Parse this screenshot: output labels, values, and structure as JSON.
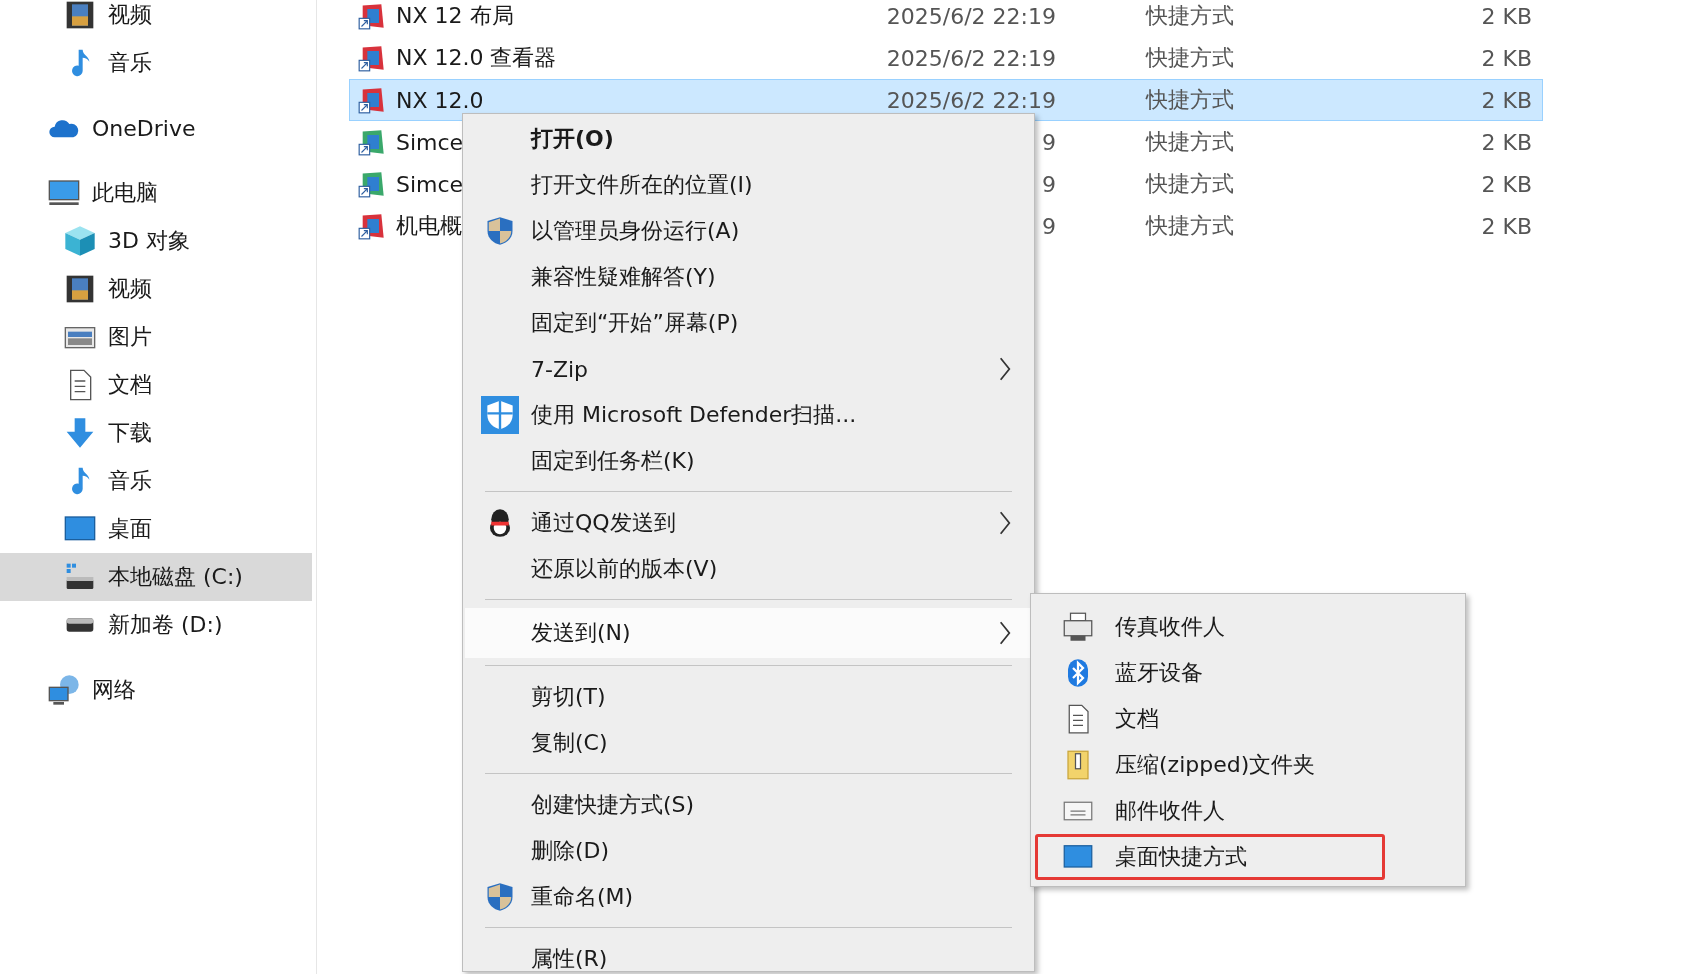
{
  "sidebar": {
    "partial_items": [
      {
        "label": "视频",
        "kind": "video",
        "selected": false
      },
      {
        "label": "音乐",
        "kind": "music",
        "selected": false
      }
    ],
    "items": [
      {
        "label": "OneDrive",
        "kind": "cloud",
        "selected": false
      },
      {
        "label": "此电脑",
        "kind": "pc",
        "selected": false,
        "children": [
          {
            "label": "3D 对象",
            "kind": "cube",
            "selected": false
          },
          {
            "label": "视频",
            "kind": "video",
            "selected": false
          },
          {
            "label": "图片",
            "kind": "pictures",
            "selected": false
          },
          {
            "label": "文档",
            "kind": "docs",
            "selected": false
          },
          {
            "label": "下载",
            "kind": "download",
            "selected": false
          },
          {
            "label": "音乐",
            "kind": "music",
            "selected": false
          },
          {
            "label": "桌面",
            "kind": "desktop",
            "selected": false
          },
          {
            "label": "本地磁盘 (C:)",
            "kind": "systemdisk",
            "selected": true
          },
          {
            "label": "新加卷 (D:)",
            "kind": "disk",
            "selected": false
          }
        ]
      },
      {
        "label": "网络",
        "kind": "network",
        "selected": false
      }
    ]
  },
  "files": {
    "rows": [
      {
        "name": "NX 12 布局",
        "kind": "nx",
        "date": "2025/6/2 22:19",
        "type": "快捷方式",
        "size": "2 KB",
        "selected": false
      },
      {
        "name": "NX 12.0 查看器",
        "kind": "nx",
        "date": "2025/6/2 22:19",
        "type": "快捷方式",
        "size": "2 KB",
        "selected": false
      },
      {
        "name": "NX 12.0",
        "kind": "nx",
        "date": "2025/6/2 22:19",
        "type": "快捷方式",
        "size": "2 KB",
        "selected": true
      },
      {
        "name": "Simce",
        "kind": "simcenter",
        "date": "9",
        "type": "快捷方式",
        "size": "2 KB",
        "selected": false
      },
      {
        "name": "Simce",
        "kind": "simcenter",
        "date": "9",
        "type": "快捷方式",
        "size": "2 KB",
        "selected": false
      },
      {
        "name": "机电概",
        "kind": "nx",
        "date": "9",
        "type": "快捷方式",
        "size": "2 KB",
        "selected": false
      }
    ]
  },
  "context_menu": {
    "groups": [
      [
        {
          "label": "打开(O)",
          "kind": "plain",
          "default": true,
          "submenu": false,
          "selected": false
        },
        {
          "label": "打开文件所在的位置(I)",
          "kind": "plain",
          "default": false,
          "submenu": false,
          "selected": false
        },
        {
          "label": "以管理员身份运行(A)",
          "kind": "shield",
          "default": false,
          "submenu": false,
          "selected": false
        },
        {
          "label": "兼容性疑难解答(Y)",
          "kind": "plain",
          "default": false,
          "submenu": false,
          "selected": false
        },
        {
          "label": "固定到“开始”屏幕(P)",
          "kind": "plain",
          "default": false,
          "submenu": false,
          "selected": false
        },
        {
          "label": "7-Zip",
          "kind": "plain",
          "default": false,
          "submenu": true,
          "selected": false
        },
        {
          "label": "使用 Microsoft Defender扫描...",
          "kind": "defender",
          "default": false,
          "submenu": false,
          "selected": false
        },
        {
          "label": "固定到任务栏(K)",
          "kind": "plain",
          "default": false,
          "submenu": false,
          "selected": false
        }
      ],
      [
        {
          "label": "通过QQ发送到",
          "kind": "qq",
          "default": false,
          "submenu": true,
          "selected": false
        },
        {
          "label": "还原以前的版本(V)",
          "kind": "plain",
          "default": false,
          "submenu": false,
          "selected": false
        }
      ],
      [
        {
          "label": "发送到(N)",
          "kind": "plain",
          "default": false,
          "submenu": true,
          "selected": true
        }
      ],
      [
        {
          "label": "剪切(T)",
          "kind": "plain",
          "default": false,
          "submenu": false,
          "selected": false
        },
        {
          "label": "复制(C)",
          "kind": "plain",
          "default": false,
          "submenu": false,
          "selected": false
        }
      ],
      [
        {
          "label": "创建快捷方式(S)",
          "kind": "plain",
          "default": false,
          "submenu": false,
          "selected": false
        },
        {
          "label": "删除(D)",
          "kind": "plain",
          "default": false,
          "submenu": false,
          "selected": false
        },
        {
          "label": "重命名(M)",
          "kind": "shield",
          "default": false,
          "submenu": false,
          "selected": false
        }
      ],
      [
        {
          "label": "属性(R)",
          "kind": "plain",
          "default": false,
          "submenu": false,
          "selected": false
        }
      ]
    ]
  },
  "send_to_menu": {
    "items": [
      {
        "label": "传真收件人",
        "kind": "fax",
        "highlighted": false
      },
      {
        "label": "蓝牙设备",
        "kind": "bluetooth",
        "highlighted": false
      },
      {
        "label": "文档",
        "kind": "docs",
        "highlighted": false
      },
      {
        "label": "压缩(zipped)文件夹",
        "kind": "zip",
        "highlighted": false
      },
      {
        "label": "邮件收件人",
        "kind": "mail",
        "highlighted": false
      },
      {
        "label": "桌面快捷方式",
        "kind": "desktop",
        "highlighted": true
      }
    ]
  }
}
